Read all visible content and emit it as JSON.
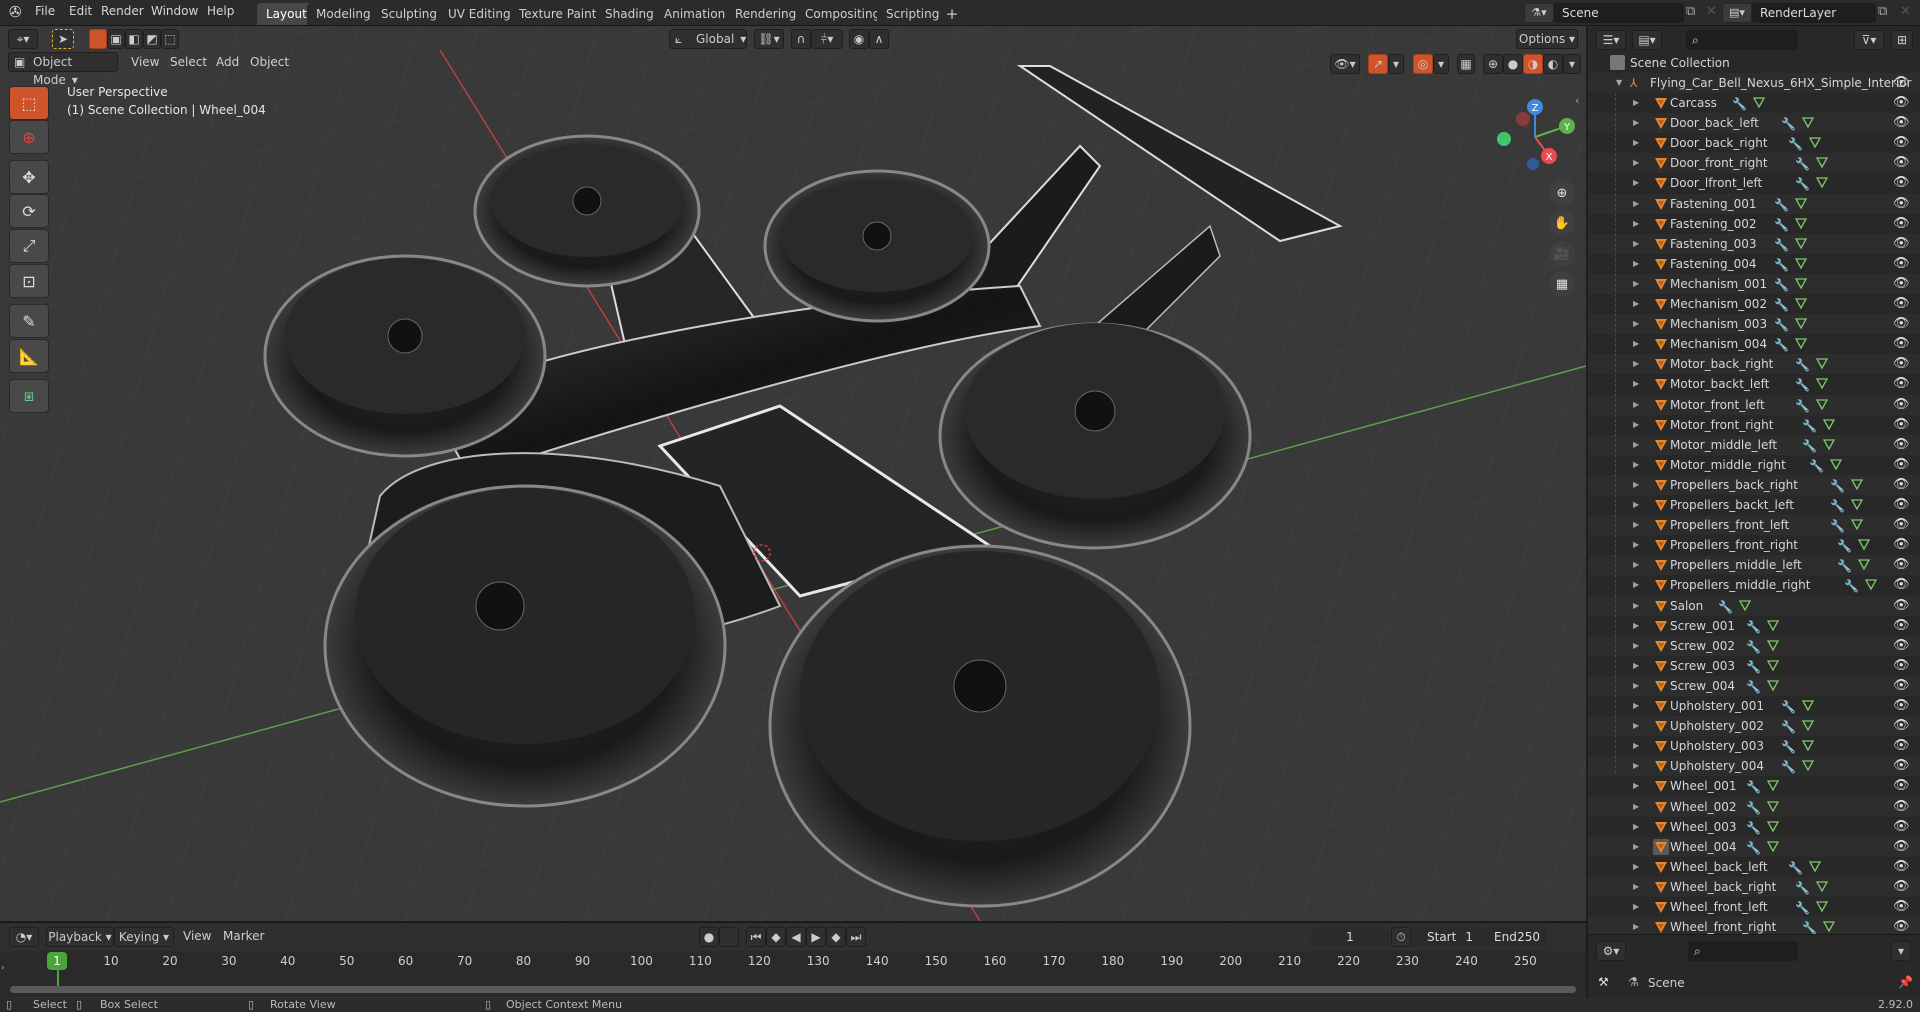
{
  "topbar": {
    "menus": [
      "File",
      "Edit",
      "Render",
      "Window",
      "Help"
    ],
    "workspace_tabs": [
      "Layout",
      "Modeling",
      "Sculpting",
      "UV Editing",
      "Texture Paint",
      "Shading",
      "Animation",
      "Rendering",
      "Compositing",
      "Scripting"
    ],
    "active_tab": "Layout",
    "add_tab": "+",
    "scene_name": "Scene",
    "view_layer": "RenderLayer"
  },
  "viewport": {
    "mode": "Object Mode",
    "menus": [
      "View",
      "Select",
      "Add",
      "Object"
    ],
    "transform_orientation": "Global",
    "options_label": "Options",
    "overlay_title": "User Perspective",
    "overlay_context": "(1) Scene Collection | Wheel_004",
    "gizmo_axes": [
      "X",
      "Y",
      "Z"
    ],
    "nav_buttons": [
      "zoom-icon",
      "pan-icon",
      "camera-icon",
      "grid-icon"
    ],
    "tools": [
      "select-box",
      "cursor",
      "move",
      "rotate",
      "scale",
      "transform",
      "annotate",
      "measure",
      "add-cube"
    ],
    "colors": {
      "accent": "#d0542a",
      "x_axis": "#e84c4c",
      "y_axis": "#5db24a",
      "z_axis": "#3d8ae0",
      "grid_bg": "#393939"
    }
  },
  "timeline": {
    "menus": [
      "Playback",
      "Keying",
      "View",
      "Marker"
    ],
    "current_frame": "1",
    "start_label": "Start",
    "start": "1",
    "end_label": "End",
    "end": "250",
    "ticks": [
      "10",
      "20",
      "30",
      "40",
      "50",
      "60",
      "70",
      "80",
      "90",
      "100",
      "110",
      "120",
      "130",
      "140",
      "150",
      "160",
      "170",
      "180",
      "190",
      "200",
      "210",
      "220",
      "230",
      "240",
      "250"
    ],
    "playhead_frame": "1"
  },
  "outliner": {
    "search_placeholder": "",
    "scene_collection": "Scene Collection",
    "collection": "Flying_Car_Bell_Nexus_6HX_Simple_Interior",
    "selected": "Wheel_004",
    "items": [
      "Carcass",
      "Door_back_left",
      "Door_back_right",
      "Door_front_right",
      "Door_lfront_left",
      "Fastening_001",
      "Fastening_002",
      "Fastening_003",
      "Fastening_004",
      "Mechanism_001",
      "Mechanism_002",
      "Mechanism_003",
      "Mechanism_004",
      "Motor_back_right",
      "Motor_backt_left",
      "Motor_front_left",
      "Motor_front_right",
      "Motor_middle_left",
      "Motor_middle_right",
      "Propellers_back_right",
      "Propellers_backt_left",
      "Propellers_front_left",
      "Propellers_front_right",
      "Propellers_middle_left",
      "Propellers_middle_right",
      "Salon",
      "Screw_001",
      "Screw_002",
      "Screw_003",
      "Screw_004",
      "Upholstery_001",
      "Upholstery_002",
      "Upholstery_003",
      "Upholstery_004",
      "Wheel_001",
      "Wheel_002",
      "Wheel_003",
      "Wheel_004",
      "Wheel_back_left",
      "Wheel_back_right",
      "Wheel_front_left",
      "Wheel_front_right"
    ]
  },
  "properties": {
    "context": "Scene"
  },
  "statusbar": {
    "select": "Select",
    "box_select": "Box Select",
    "rotate_view": "Rotate View",
    "context_menu": "Object Context Menu",
    "version": "2.92.0"
  }
}
